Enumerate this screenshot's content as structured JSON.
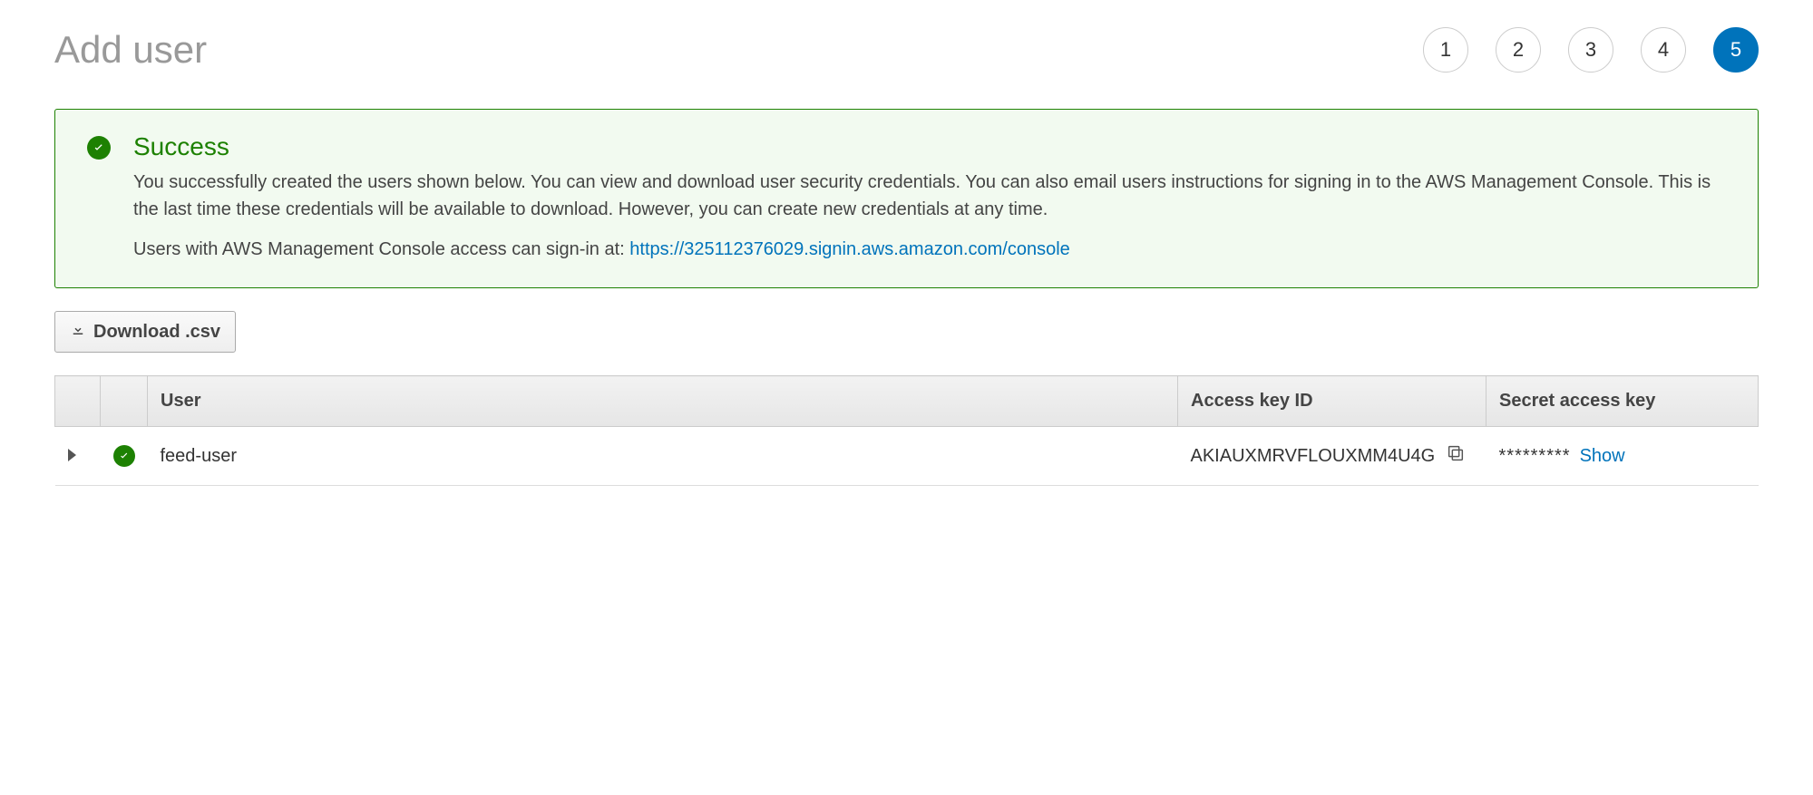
{
  "page": {
    "title": "Add user"
  },
  "wizard": {
    "steps": [
      "1",
      "2",
      "3",
      "4",
      "5"
    ],
    "active_index": 4
  },
  "banner": {
    "title": "Success",
    "body": "You successfully created the users shown below. You can view and download user security credentials. You can also email users instructions for signing in to the AWS Management Console. This is the last time these credentials will be available to download. However, you can create new credentials at any time.",
    "signin_prefix": "Users with AWS Management Console access can sign-in at: ",
    "signin_url": "https://325112376029.signin.aws.amazon.com/console"
  },
  "actions": {
    "download_csv_label": "Download .csv"
  },
  "table": {
    "columns": {
      "user": "User",
      "access_key_id": "Access key ID",
      "secret_access_key": "Secret access key"
    },
    "rows": [
      {
        "user": "feed-user",
        "access_key_id": "AKIAUXMRVFLOUXMM4U4G",
        "secret_masked": "*********",
        "show_label": "Show"
      }
    ]
  }
}
